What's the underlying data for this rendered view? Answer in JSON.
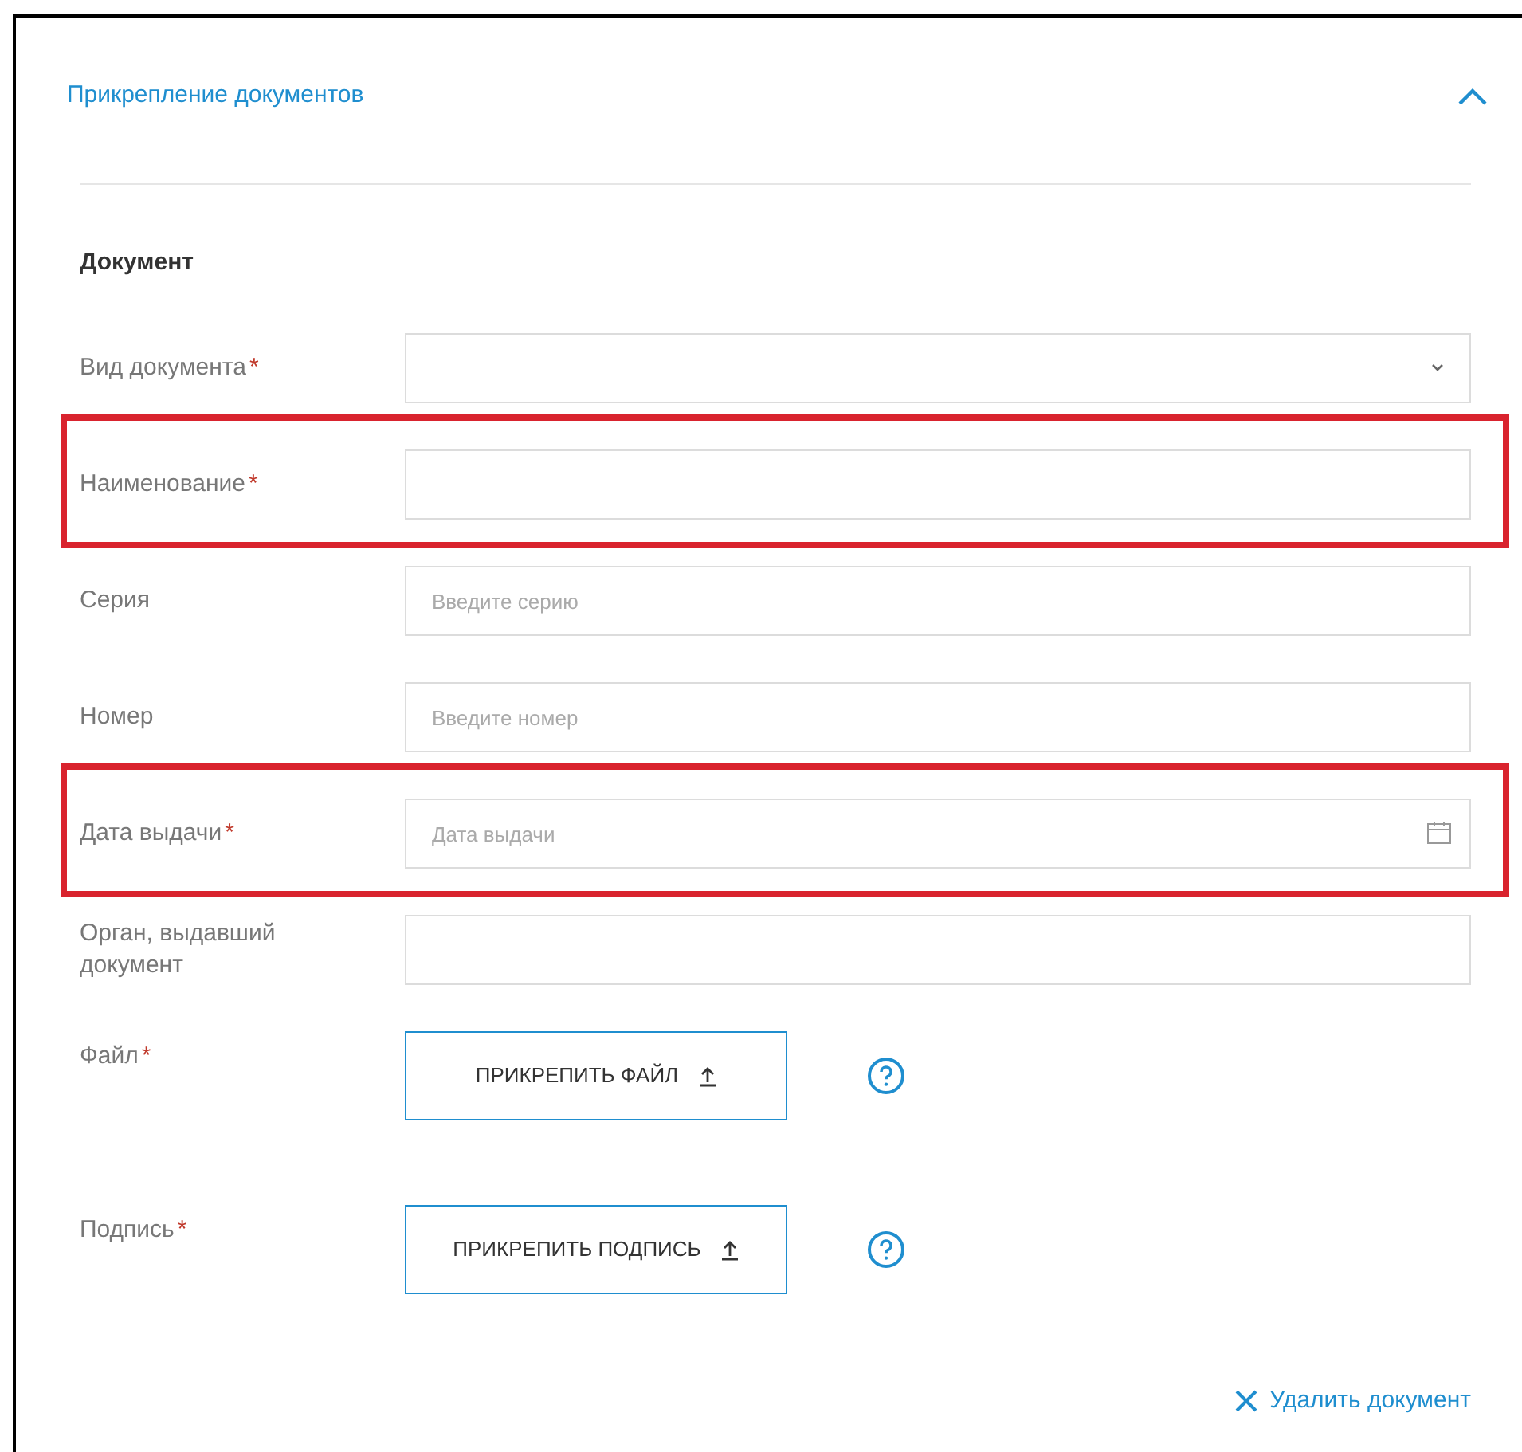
{
  "section": {
    "title": "Прикрепление документов",
    "expanded": true
  },
  "form": {
    "title": "Документ",
    "fields": [
      {
        "kind": "select",
        "label": "Вид документа",
        "required_mark": "*",
        "highlighted": false
      },
      {
        "kind": "text",
        "label": "Наименование",
        "required_mark": "*",
        "highlighted": true
      },
      {
        "kind": "text",
        "label": "Серия",
        "highlighted": false,
        "placeholder": "Введите серию"
      },
      {
        "kind": "text",
        "label": "Номер",
        "highlighted": false,
        "placeholder": "Введите номер"
      },
      {
        "kind": "date",
        "label": "Дата выдачи",
        "required_mark": "*",
        "highlighted": true,
        "placeholder": "Дата выдачи"
      },
      {
        "kind": "text",
        "label": "Орган, выдавший документ",
        "highlighted": false
      },
      {
        "kind": "file",
        "label": "Файл",
        "required_mark": "*",
        "highlighted": false,
        "button": "ПРИКРЕПИТЬ ФАЙЛ"
      },
      {
        "kind": "file",
        "label": "Подпись",
        "required_mark": "*",
        "highlighted": false,
        "button": "ПРИКРЕПИТЬ ПОДПИСЬ"
      }
    ],
    "delete_link": "Удалить документ"
  }
}
